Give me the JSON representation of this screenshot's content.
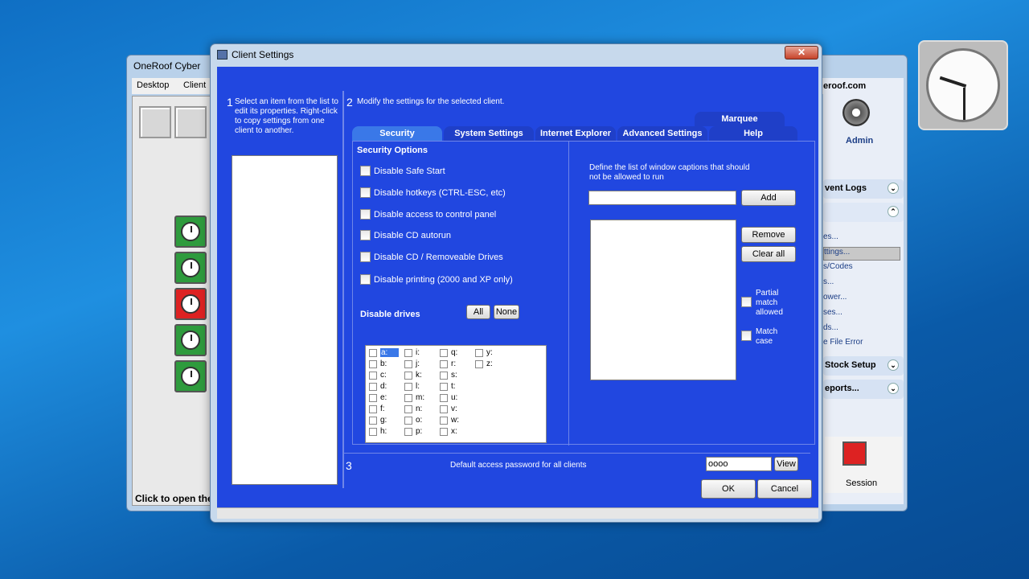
{
  "background_app": {
    "title": "OneRoof Cyber",
    "menu": [
      "Desktop",
      "Client"
    ],
    "status_text": "Click to open the",
    "site": "eroof.com",
    "admin_label": "Admin",
    "sections": [
      {
        "label": "vent Logs"
      },
      {
        "label": "Stock Setup"
      },
      {
        "label": "eports..."
      }
    ],
    "links": [
      "es...",
      "ttings...",
      "s/Codes",
      "s...",
      "ower...",
      "ses...",
      "ds...",
      "e File Error"
    ],
    "session_label": "Session"
  },
  "dialog": {
    "title": "Client Settings",
    "step1_num": "1",
    "step1_text": "Select an item from the list to edit its properties. Right-click to copy settings from one client to another.",
    "step2_num": "2",
    "step2_text": "Modify the settings for the selected client.",
    "tabs": [
      "Marquee",
      "Security",
      "System Settings",
      "Internet Explorer",
      "Advanced Settings",
      "Help"
    ],
    "security_options_title": "Security Options",
    "options": [
      "Disable Safe Start",
      "Disable hotkeys (CTRL-ESC, etc)",
      "Disable access to control panel",
      "Disable CD autorun",
      "Disable CD / Removeable Drives",
      "Disable printing (2000 and XP only)"
    ],
    "disable_drives_label": "Disable drives",
    "all_button": "All",
    "none_button": "None",
    "drives": [
      "a:",
      "b:",
      "c:",
      "d:",
      "e:",
      "f:",
      "g:",
      "h:",
      "i:",
      "j:",
      "k:",
      "l:",
      "m:",
      "n:",
      "o:",
      "p:",
      "q:",
      "r:",
      "s:",
      "t:",
      "u:",
      "v:",
      "w:",
      "x:",
      "y:",
      "z:"
    ],
    "captions_text": "Define the list of window captions that should not be allowed to run",
    "add_button": "Add",
    "remove_button": "Remove",
    "clear_all_button": "Clear all",
    "partial_match": "Partial match allowed",
    "match_case": "Match case",
    "step3_num": "3",
    "password_label": "Default access password for all clients",
    "password_value": "oooo",
    "view_button": "View",
    "ok_button": "OK",
    "cancel_button": "Cancel",
    "close_glyph": "✕"
  }
}
